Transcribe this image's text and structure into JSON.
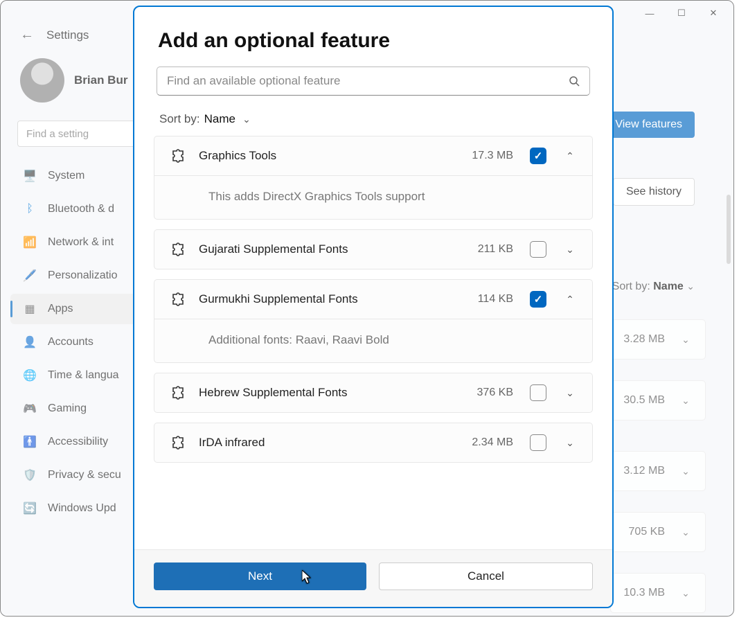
{
  "settings": {
    "title": "Settings",
    "user_name": "Brian Bur",
    "search_placeholder": "Find a setting",
    "nav": [
      {
        "icon": "🖥️",
        "label": "System"
      },
      {
        "icon": "ᛒ",
        "label": "Bluetooth & d"
      },
      {
        "icon": "📶",
        "label": "Network & int"
      },
      {
        "icon": "🖊️",
        "label": "Personalizatio"
      },
      {
        "icon": "▦",
        "label": "Apps"
      },
      {
        "icon": "👤",
        "label": "Accounts"
      },
      {
        "icon": "🌐",
        "label": "Time & langua"
      },
      {
        "icon": "🎮",
        "label": "Gaming"
      },
      {
        "icon": "🚹",
        "label": "Accessibility"
      },
      {
        "icon": "🛡️",
        "label": "Privacy & secu"
      },
      {
        "icon": "🔄",
        "label": "Windows Upd"
      }
    ],
    "view_features": "View features",
    "see_history": "See history",
    "sort_label": "Sort by:",
    "sort_value": "Name",
    "bg_rows": [
      "3.28 MB",
      "30.5 MB",
      "3.12 MB",
      "705 KB",
      "10.3 MB"
    ]
  },
  "dialog": {
    "title": "Add an optional feature",
    "search_placeholder": "Find an available optional feature",
    "sort_label": "Sort by:",
    "sort_value": "Name",
    "features": [
      {
        "name": "Graphics Tools",
        "size": "17.3 MB",
        "checked": true,
        "expanded": true,
        "desc": "This adds DirectX Graphics Tools support"
      },
      {
        "name": "Gujarati Supplemental Fonts",
        "size": "211 KB",
        "checked": false,
        "expanded": false
      },
      {
        "name": "Gurmukhi Supplemental Fonts",
        "size": "114 KB",
        "checked": true,
        "expanded": true,
        "desc": "Additional fonts: Raavi, Raavi Bold"
      },
      {
        "name": "Hebrew Supplemental Fonts",
        "size": "376 KB",
        "checked": false,
        "expanded": false
      },
      {
        "name": "IrDA infrared",
        "size": "2.34 MB",
        "checked": false,
        "expanded": false
      }
    ],
    "next": "Next",
    "cancel": "Cancel"
  }
}
